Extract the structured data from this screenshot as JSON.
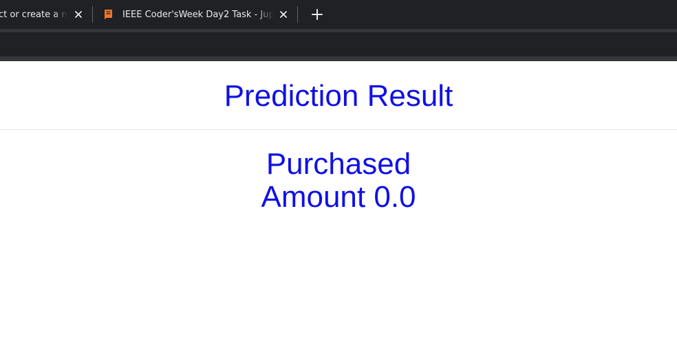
{
  "browser": {
    "tabs": [
      {
        "title": "ct or create a n",
        "close_label": "×"
      },
      {
        "title": "IEEE Coder'sWeek Day2 Task - Jup",
        "close_label": "×"
      }
    ],
    "new_tab_label": "+",
    "icons": {
      "favicon": "jupyter-notebook-icon",
      "close": "close-icon",
      "new_tab": "plus-icon"
    },
    "colors": {
      "chrome_bg": "#202124",
      "tab_text": "#e8eaed",
      "favicon": "#f37626"
    }
  },
  "page": {
    "title": "Prediction Result",
    "result_line1": "Purchased",
    "result_line2": "Amount 0.0",
    "colors": {
      "text": "#1010e6",
      "background": "#ffffff"
    }
  }
}
